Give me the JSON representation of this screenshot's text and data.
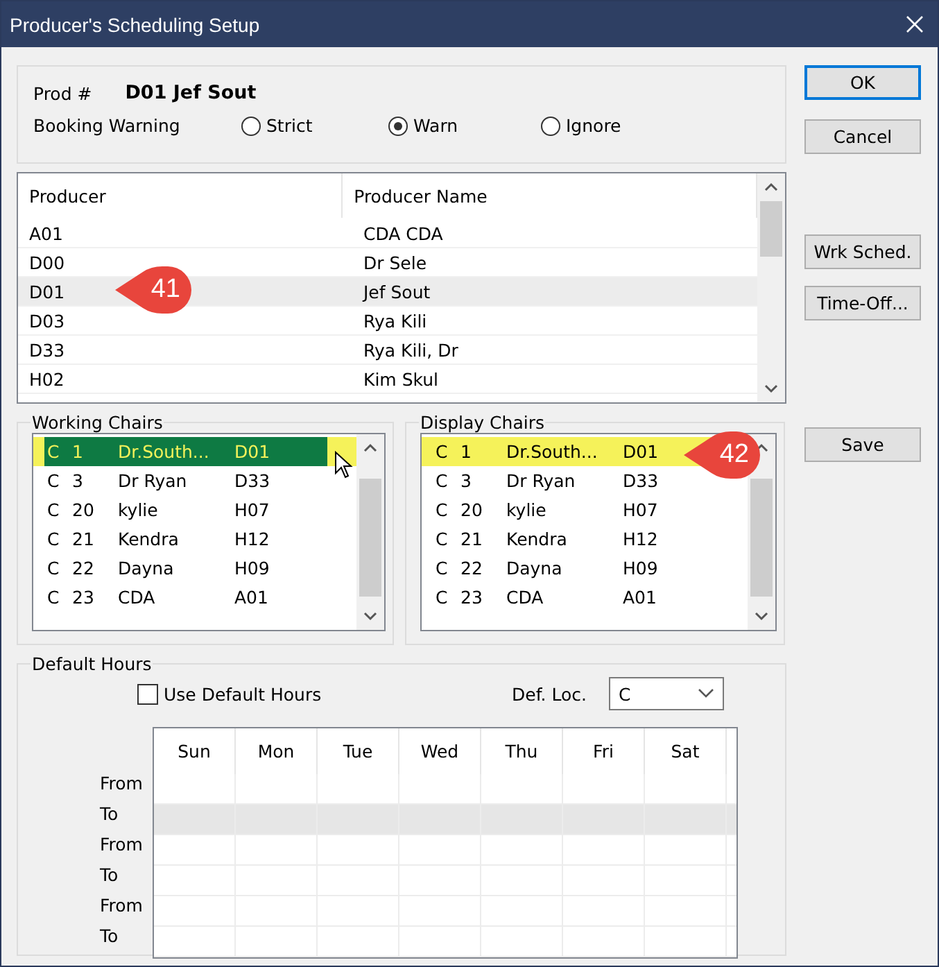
{
  "window": {
    "title": "Producer's Scheduling Setup"
  },
  "prod": {
    "label": "Prod #",
    "value": "D01 Jef Sout"
  },
  "booking_warning": {
    "label": "Booking Warning",
    "options": [
      {
        "label": "Strict",
        "selected": false
      },
      {
        "label": "Warn",
        "selected": true
      },
      {
        "label": "Ignore",
        "selected": false
      }
    ]
  },
  "producers": {
    "columns": [
      "Producer",
      "Producer Name"
    ],
    "rows": [
      {
        "code": "A01",
        "name": "CDA CDA",
        "selected": false
      },
      {
        "code": "D00",
        "name": "Dr Sele",
        "selected": false
      },
      {
        "code": "D01",
        "name": "Jef Sout",
        "selected": true
      },
      {
        "code": "D03",
        "name": "Rya Kili",
        "selected": false
      },
      {
        "code": "D33",
        "name": "Rya Kili, Dr",
        "selected": false
      },
      {
        "code": "H02",
        "name": "Kim Skul",
        "selected": false
      }
    ]
  },
  "chair_lists": [
    {
      "title": "Working Chairs",
      "focused": true,
      "rows": [
        {
          "loc": "C",
          "num": "1",
          "name": "Dr.South...",
          "code": "D01",
          "selected": true
        },
        {
          "loc": "C",
          "num": "3",
          "name": "Dr Ryan",
          "code": "D33",
          "selected": false
        },
        {
          "loc": "C",
          "num": "20",
          "name": "kylie",
          "code": "H07",
          "selected": false
        },
        {
          "loc": "C",
          "num": "21",
          "name": "Kendra",
          "code": "H12",
          "selected": false
        },
        {
          "loc": "C",
          "num": "22",
          "name": "Dayna",
          "code": "H09",
          "selected": false
        },
        {
          "loc": "C",
          "num": "23",
          "name": "CDA",
          "code": "A01",
          "selected": false
        }
      ]
    },
    {
      "title": "Display Chairs",
      "focused": false,
      "rows": [
        {
          "loc": "C",
          "num": "1",
          "name": "Dr.South...",
          "code": "D01",
          "selected": true
        },
        {
          "loc": "C",
          "num": "3",
          "name": "Dr Ryan",
          "code": "D33",
          "selected": false
        },
        {
          "loc": "C",
          "num": "20",
          "name": "kylie",
          "code": "H07",
          "selected": false
        },
        {
          "loc": "C",
          "num": "21",
          "name": "Kendra",
          "code": "H12",
          "selected": false
        },
        {
          "loc": "C",
          "num": "22",
          "name": "Dayna",
          "code": "H09",
          "selected": false
        },
        {
          "loc": "C",
          "num": "23",
          "name": "CDA",
          "code": "A01",
          "selected": false
        }
      ]
    }
  ],
  "default_hours": {
    "title": "Default Hours",
    "use_default": {
      "label": "Use Default Hours",
      "checked": false
    },
    "def_loc": {
      "label": "Def. Loc.",
      "value": "C"
    },
    "days": [
      "Sun",
      "Mon",
      "Tue",
      "Wed",
      "Thu",
      "Fri",
      "Sat"
    ],
    "rows": [
      {
        "label": "From",
        "selected": false
      },
      {
        "label": "To",
        "selected": true
      },
      {
        "label": "From",
        "selected": false
      },
      {
        "label": "To",
        "selected": false
      },
      {
        "label": "From",
        "selected": false
      },
      {
        "label": "To",
        "selected": false
      }
    ]
  },
  "buttons": [
    {
      "label": "OK",
      "kind": "default"
    },
    {
      "label": "Cancel",
      "kind": "normal"
    },
    {
      "label": "Wrk Sched.",
      "kind": "normal"
    },
    {
      "label": "Time-Off...",
      "kind": "normal"
    },
    {
      "label": "Save",
      "kind": "normal"
    }
  ],
  "callouts": [
    {
      "text": "41"
    },
    {
      "text": "42"
    }
  ]
}
